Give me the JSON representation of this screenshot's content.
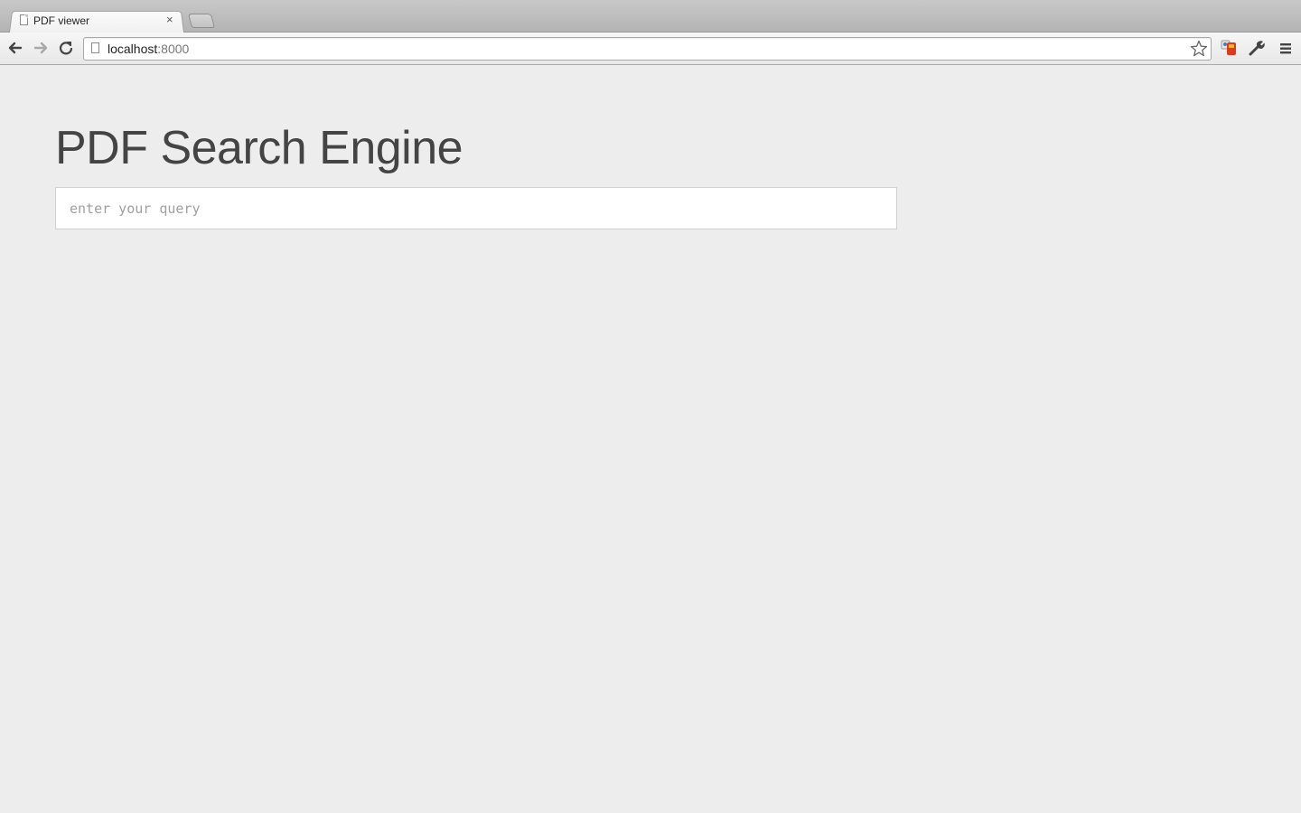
{
  "browser": {
    "tab": {
      "title": "PDF viewer",
      "close_symbol": "×"
    },
    "address_bar": {
      "host": "localhost",
      "port": ":8000"
    },
    "icons": {
      "back": "back-arrow-icon",
      "forward": "forward-arrow-icon",
      "reload": "reload-icon",
      "page": "page-icon",
      "bookmark": "star-icon",
      "extension": "extension-icon",
      "wrench": "wrench-icon",
      "menu": "menu-icon"
    }
  },
  "page": {
    "title": "PDF Search Engine",
    "search": {
      "placeholder": "enter your query",
      "value": ""
    }
  },
  "colors": {
    "page_background": "#ededed",
    "title_text": "#444444",
    "placeholder_text": "#a0a0a0"
  }
}
